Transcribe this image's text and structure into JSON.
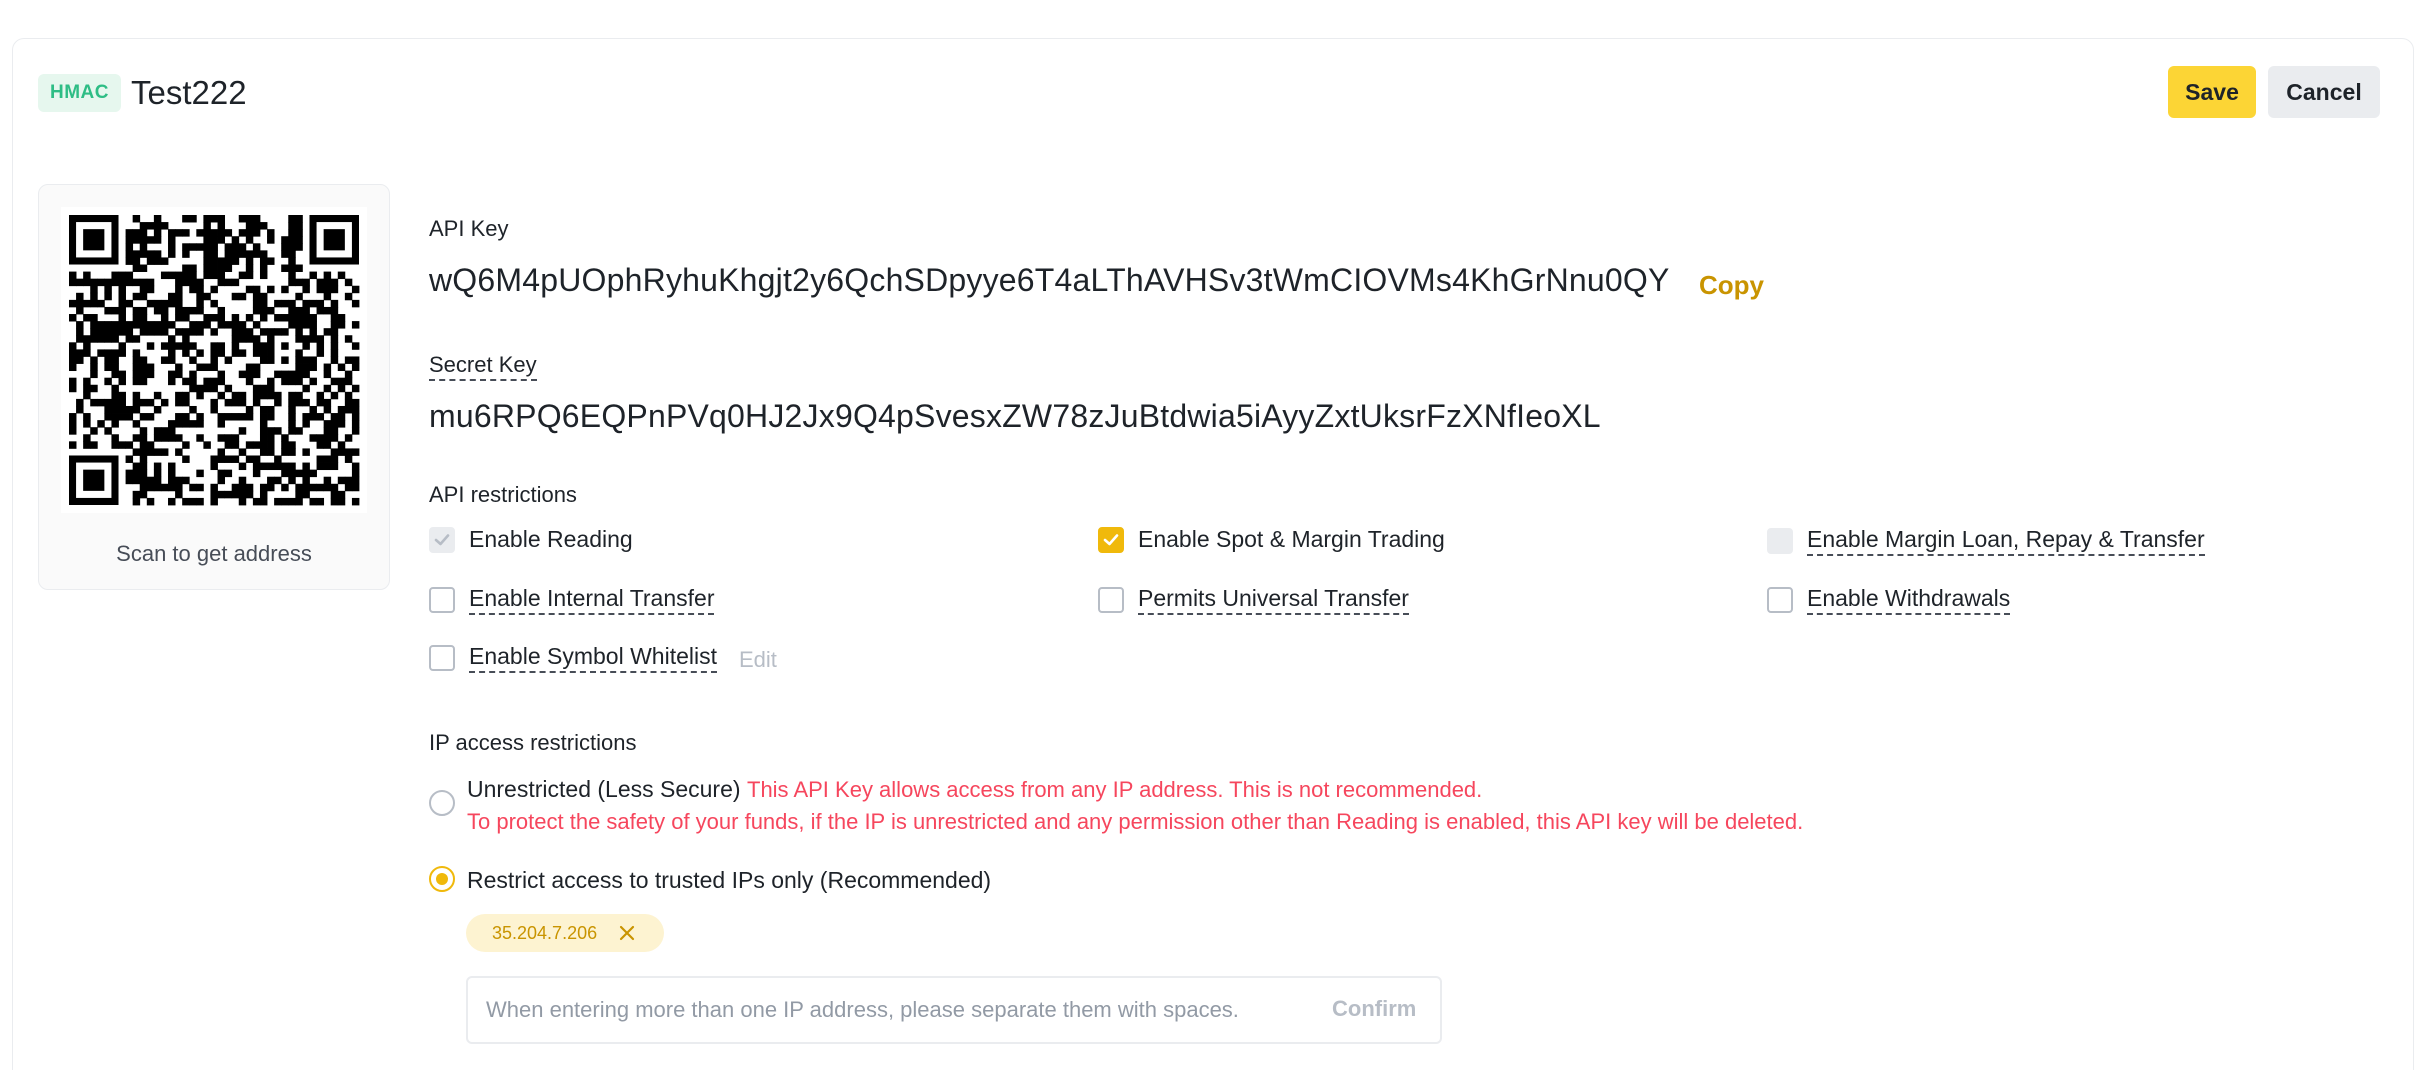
{
  "header": {
    "badge": "HMAC",
    "title": "Test222",
    "save_label": "Save",
    "cancel_label": "Cancel"
  },
  "qr": {
    "caption": "Scan to get address"
  },
  "api_key": {
    "label": "API Key",
    "value": "wQ6M4pUOphRyhuKhgjt2y6QchSDpyye6T4aLThAVHSv3tWmCIOVMs4KhGrNnu0QY",
    "copy_label": "Copy"
  },
  "secret_key": {
    "label": "Secret Key",
    "value": "mu6RPQ6EQPnPVq0HJ2Jx9Q4pSvesxZW78zJuBtdwia5iAyyZxtUksrFzXNfIeoXL"
  },
  "restrictions": {
    "label": "API restrictions",
    "items": [
      {
        "label": "Enable Reading",
        "state": "checked-disabled"
      },
      {
        "label": "Enable Spot & Margin Trading",
        "state": "checked"
      },
      {
        "label": "Enable Margin Loan, Repay & Transfer",
        "state": "disabled"
      },
      {
        "label": "Enable Internal Transfer",
        "state": "unchecked"
      },
      {
        "label": "Permits Universal Transfer",
        "state": "unchecked"
      },
      {
        "label": "Enable Withdrawals",
        "state": "unchecked"
      },
      {
        "label": "Enable Symbol Whitelist",
        "state": "unchecked"
      }
    ],
    "edit_label": "Edit"
  },
  "ip_access": {
    "label": "IP access restrictions",
    "unrestricted_label": "Unrestricted (Less Secure)",
    "unrestricted_warning_1": "This API Key allows access from any IP address. This is not recommended.",
    "unrestricted_warning_2": "To protect the safety of your funds, if the IP is unrestricted and any permission other than Reading is enabled, this API key will be deleted.",
    "restricted_label": "Restrict access to trusted IPs only (Recommended)",
    "selected": "restricted",
    "ips": [
      "35.204.7.206"
    ],
    "input_placeholder": "When entering more than one IP address, please separate them with spaces.",
    "input_value": "",
    "confirm_label": "Confirm"
  },
  "colors": {
    "accent": "#fcd535",
    "accent_text": "#c99400",
    "checkbox_checked": "#f0b90b",
    "warning": "#f6465d",
    "badge_bg": "#e6f7ee",
    "badge_text": "#2ebd85"
  }
}
